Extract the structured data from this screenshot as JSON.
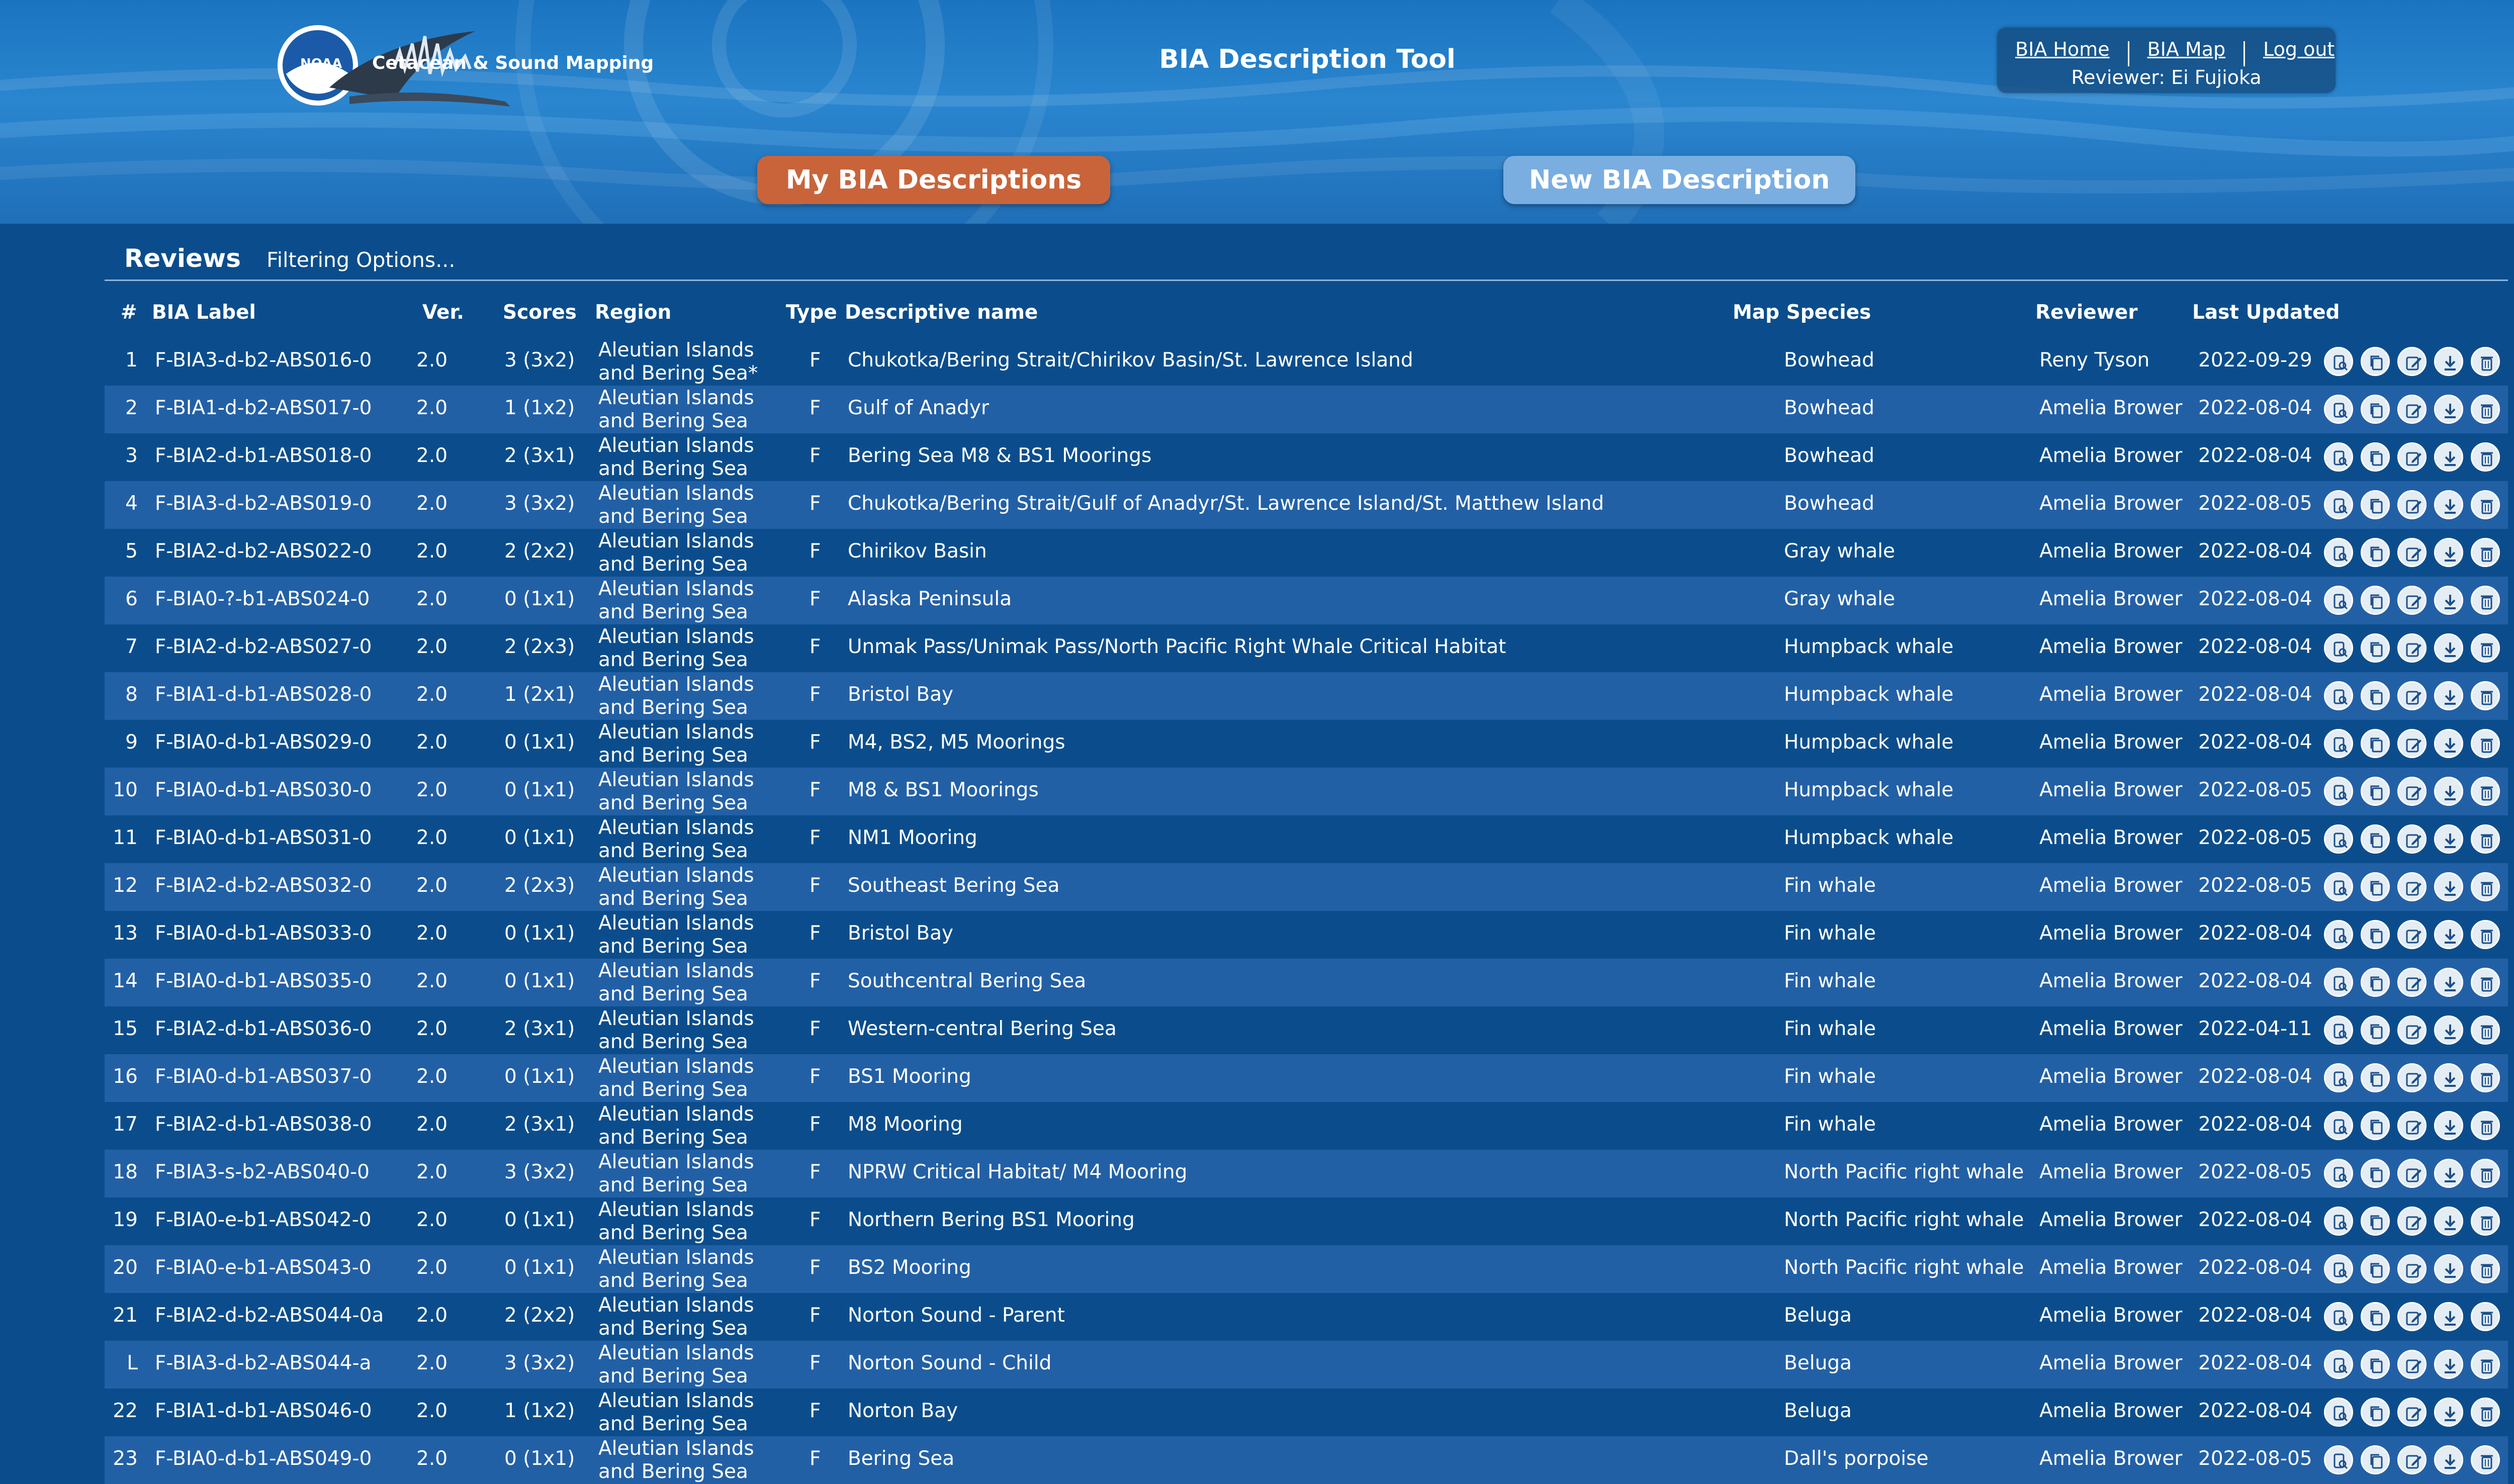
{
  "header": {
    "logo_text": "Cetacean & Sound Mapping",
    "noaa_text": "NOAA",
    "app_title": "BIA Description Tool",
    "nav": {
      "home": "BIA Home",
      "map": "BIA Map",
      "logout": "Log out",
      "reviewer": "Reviewer: Ei Fujioka"
    },
    "buttons": {
      "my_descriptions": "My BIA Descriptions",
      "new_description": "New BIA Description"
    }
  },
  "reviews": {
    "title": "Reviews",
    "filter_label": "Filtering Options...",
    "columns": {
      "num": "#",
      "label": "BIA Label",
      "ver": "Ver.",
      "scores": "Scores",
      "region": "Region",
      "type": "Type",
      "name": "Descriptive name",
      "species": "Map Species",
      "reviewer": "Reviewer",
      "updated": "Last Updated"
    },
    "region_text": "Aleutian Islands and Bering Sea",
    "row_actions": [
      "view-icon",
      "copy-icon",
      "edit-icon",
      "download-icon",
      "delete-icon"
    ],
    "rows": [
      {
        "num": "1",
        "label": "F-BIA3-d-b2-ABS016-0",
        "ver": "2.0",
        "score": "3 (3x2)",
        "region": "Aleutian Islands and Bering Sea*",
        "type": "F",
        "name": "Chukotka/Bering Strait/Chirikov Basin/St. Lawrence Island",
        "species": "Bowhead",
        "reviewer": "Reny Tyson",
        "date": "2022-09-29"
      },
      {
        "num": "2",
        "label": "F-BIA1-d-b2-ABS017-0",
        "ver": "2.0",
        "score": "1 (1x2)",
        "region": "Aleutian Islands and Bering Sea",
        "type": "F",
        "name": "Gulf of Anadyr",
        "species": "Bowhead",
        "reviewer": "Amelia Brower",
        "date": "2022-08-04"
      },
      {
        "num": "3",
        "label": "F-BIA2-d-b1-ABS018-0",
        "ver": "2.0",
        "score": "2 (3x1)",
        "region": "Aleutian Islands and Bering Sea",
        "type": "F",
        "name": "Bering Sea M8 & BS1 Moorings",
        "species": "Bowhead",
        "reviewer": "Amelia Brower",
        "date": "2022-08-04"
      },
      {
        "num": "4",
        "label": "F-BIA3-d-b2-ABS019-0",
        "ver": "2.0",
        "score": "3 (3x2)",
        "region": "Aleutian Islands and Bering Sea",
        "type": "F",
        "name": "Chukotka/Bering Strait/Gulf of Anadyr/St. Lawrence Island/St. Matthew Island",
        "species": "Bowhead",
        "reviewer": "Amelia Brower",
        "date": "2022-08-05"
      },
      {
        "num": "5",
        "label": "F-BIA2-d-b2-ABS022-0",
        "ver": "2.0",
        "score": "2 (2x2)",
        "region": "Aleutian Islands and Bering Sea",
        "type": "F",
        "name": "Chirikov Basin",
        "species": "Gray whale",
        "reviewer": "Amelia Brower",
        "date": "2022-08-04"
      },
      {
        "num": "6",
        "label": "F-BIA0-?-b1-ABS024-0",
        "ver": "2.0",
        "score": "0 (1x1)",
        "region": "Aleutian Islands and Bering Sea",
        "type": "F",
        "name": "Alaska Peninsula",
        "species": "Gray whale",
        "reviewer": "Amelia Brower",
        "date": "2022-08-04"
      },
      {
        "num": "7",
        "label": "F-BIA2-d-b2-ABS027-0",
        "ver": "2.0",
        "score": "2 (2x3)",
        "region": "Aleutian Islands and Bering Sea",
        "type": "F",
        "name": "Unmak Pass/Unimak Pass/North Pacific Right Whale Critical Habitat",
        "species": "Humpback whale",
        "reviewer": "Amelia Brower",
        "date": "2022-08-04"
      },
      {
        "num": "8",
        "label": "F-BIA1-d-b1-ABS028-0",
        "ver": "2.0",
        "score": "1 (2x1)",
        "region": "Aleutian Islands and Bering Sea",
        "type": "F",
        "name": "Bristol Bay",
        "species": "Humpback whale",
        "reviewer": "Amelia Brower",
        "date": "2022-08-04"
      },
      {
        "num": "9",
        "label": "F-BIA0-d-b1-ABS029-0",
        "ver": "2.0",
        "score": "0 (1x1)",
        "region": "Aleutian Islands and Bering Sea",
        "type": "F",
        "name": "M4, BS2, M5 Moorings",
        "species": "Humpback whale",
        "reviewer": "Amelia Brower",
        "date": "2022-08-04"
      },
      {
        "num": "10",
        "label": "F-BIA0-d-b1-ABS030-0",
        "ver": "2.0",
        "score": "0 (1x1)",
        "region": "Aleutian Islands and Bering Sea",
        "type": "F",
        "name": "M8 & BS1 Moorings",
        "species": "Humpback whale",
        "reviewer": "Amelia Brower",
        "date": "2022-08-05"
      },
      {
        "num": "11",
        "label": "F-BIA0-d-b1-ABS031-0",
        "ver": "2.0",
        "score": "0 (1x1)",
        "region": "Aleutian Islands and Bering Sea",
        "type": "F",
        "name": "NM1 Mooring",
        "species": "Humpback whale",
        "reviewer": "Amelia Brower",
        "date": "2022-08-05"
      },
      {
        "num": "12",
        "label": "F-BIA2-d-b2-ABS032-0",
        "ver": "2.0",
        "score": "2 (2x3)",
        "region": "Aleutian Islands and Bering Sea",
        "type": "F",
        "name": "Southeast Bering Sea",
        "species": "Fin whale",
        "reviewer": "Amelia Brower",
        "date": "2022-08-05"
      },
      {
        "num": "13",
        "label": "F-BIA0-d-b1-ABS033-0",
        "ver": "2.0",
        "score": "0 (1x1)",
        "region": "Aleutian Islands and Bering Sea",
        "type": "F",
        "name": "Bristol Bay",
        "species": "Fin whale",
        "reviewer": "Amelia Brower",
        "date": "2022-08-04"
      },
      {
        "num": "14",
        "label": "F-BIA0-d-b1-ABS035-0",
        "ver": "2.0",
        "score": "0 (1x1)",
        "region": "Aleutian Islands and Bering Sea",
        "type": "F",
        "name": "Southcentral Bering Sea",
        "species": "Fin whale",
        "reviewer": "Amelia Brower",
        "date": "2022-08-04"
      },
      {
        "num": "15",
        "label": "F-BIA2-d-b1-ABS036-0",
        "ver": "2.0",
        "score": "2 (3x1)",
        "region": "Aleutian Islands and Bering Sea",
        "type": "F",
        "name": "Western-central Bering Sea",
        "species": "Fin whale",
        "reviewer": "Amelia Brower",
        "date": "2022-04-11"
      },
      {
        "num": "16",
        "label": "F-BIA0-d-b1-ABS037-0",
        "ver": "2.0",
        "score": "0 (1x1)",
        "region": "Aleutian Islands and Bering Sea",
        "type": "F",
        "name": "BS1 Mooring",
        "species": "Fin whale",
        "reviewer": "Amelia Brower",
        "date": "2022-08-04"
      },
      {
        "num": "17",
        "label": "F-BIA2-d-b1-ABS038-0",
        "ver": "2.0",
        "score": "2 (3x1)",
        "region": "Aleutian Islands and Bering Sea",
        "type": "F",
        "name": "M8 Mooring",
        "species": "Fin whale",
        "reviewer": "Amelia Brower",
        "date": "2022-08-04"
      },
      {
        "num": "18",
        "label": "F-BIA3-s-b2-ABS040-0",
        "ver": "2.0",
        "score": "3 (3x2)",
        "region": "Aleutian Islands and Bering Sea",
        "type": "F",
        "name": "NPRW Critical Habitat/ M4 Mooring",
        "species": "North Pacific right whale",
        "reviewer": "Amelia Brower",
        "date": "2022-08-05"
      },
      {
        "num": "19",
        "label": "F-BIA0-e-b1-ABS042-0",
        "ver": "2.0",
        "score": "0 (1x1)",
        "region": "Aleutian Islands and Bering Sea",
        "type": "F",
        "name": "Northern Bering BS1 Mooring",
        "species": "North Pacific right whale",
        "reviewer": "Amelia Brower",
        "date": "2022-08-04"
      },
      {
        "num": "20",
        "label": "F-BIA0-e-b1-ABS043-0",
        "ver": "2.0",
        "score": "0 (1x1)",
        "region": "Aleutian Islands and Bering Sea",
        "type": "F",
        "name": "BS2 Mooring",
        "species": "North Pacific right whale",
        "reviewer": "Amelia Brower",
        "date": "2022-08-04"
      },
      {
        "num": "21",
        "label": "F-BIA2-d-b2-ABS044-0a",
        "ver": "2.0",
        "score": "2 (2x2)",
        "region": "Aleutian Islands and Bering Sea",
        "type": "F",
        "name": "Norton Sound - Parent",
        "species": "Beluga",
        "reviewer": "Amelia Brower",
        "date": "2022-08-04"
      },
      {
        "num": "L",
        "label": "F-BIA3-d-b2-ABS044-a",
        "ver": "2.0",
        "score": "3 (3x2)",
        "region": "Aleutian Islands and Bering Sea",
        "type": "F",
        "name": "Norton Sound - Child",
        "species": "Beluga",
        "reviewer": "Amelia Brower",
        "date": "2022-08-04"
      },
      {
        "num": "22",
        "label": "F-BIA1-d-b1-ABS046-0",
        "ver": "2.0",
        "score": "1 (1x2)",
        "region": "Aleutian Islands and Bering Sea",
        "type": "F",
        "name": "Norton Bay",
        "species": "Beluga",
        "reviewer": "Amelia Brower",
        "date": "2022-08-04"
      },
      {
        "num": "23",
        "label": "F-BIA0-d-b1-ABS049-0",
        "ver": "2.0",
        "score": "0 (1x1)",
        "region": "Aleutian Islands and Bering Sea",
        "type": "F",
        "name": "Bering Sea",
        "species": "Dall's porpoise",
        "reviewer": "Amelia Brower",
        "date": "2022-08-05"
      }
    ]
  }
}
